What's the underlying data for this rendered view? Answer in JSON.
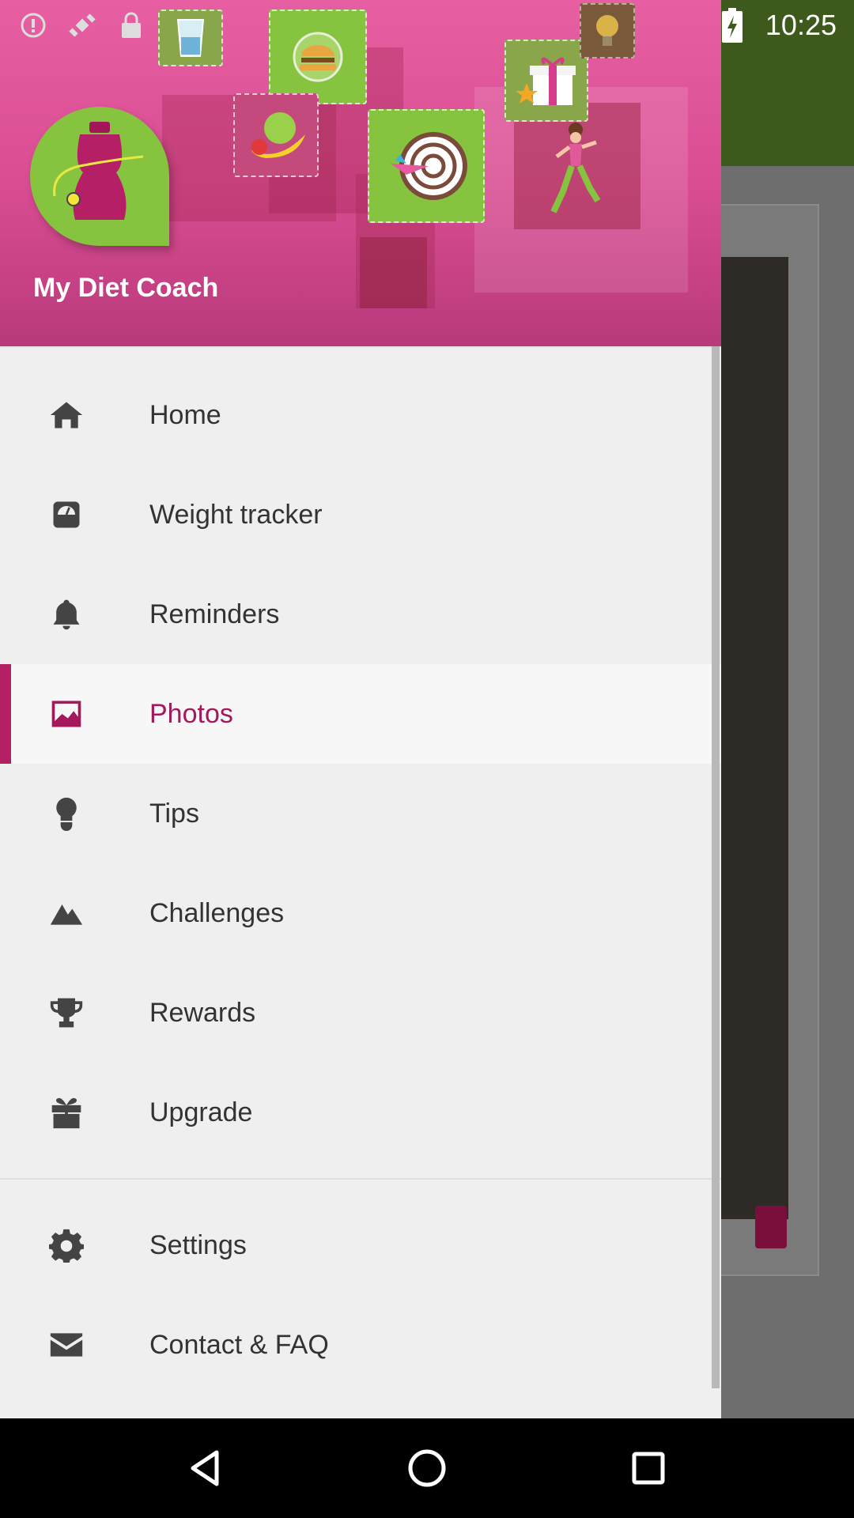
{
  "status_bar": {
    "time": "10:25",
    "left_icons": [
      "alert-icon",
      "fake-gps-icon",
      "lock-icon",
      "android-icon"
    ],
    "right_icons": [
      "wifi-icon",
      "signal-icon",
      "battery-charging-icon"
    ]
  },
  "drawer": {
    "app_name": "My Diet Coach",
    "accent_color": "#b51f66",
    "items": [
      {
        "label": "Home",
        "icon": "home-icon"
      },
      {
        "label": "Weight tracker",
        "icon": "scale-icon"
      },
      {
        "label": "Reminders",
        "icon": "bell-icon"
      },
      {
        "label": "Photos",
        "icon": "image-icon",
        "active": true
      },
      {
        "label": "Tips",
        "icon": "lightbulb-icon"
      },
      {
        "label": "Challenges",
        "icon": "mountain-icon"
      },
      {
        "label": "Rewards",
        "icon": "trophy-icon"
      },
      {
        "label": "Upgrade",
        "icon": "gift-icon"
      }
    ],
    "secondary_items": [
      {
        "label": "Settings",
        "icon": "gear-icon"
      },
      {
        "label": "Contact & FAQ",
        "icon": "mail-icon"
      }
    ]
  },
  "nav_bar": {
    "buttons": [
      "back-icon",
      "home-circle-icon",
      "recents-icon"
    ]
  }
}
